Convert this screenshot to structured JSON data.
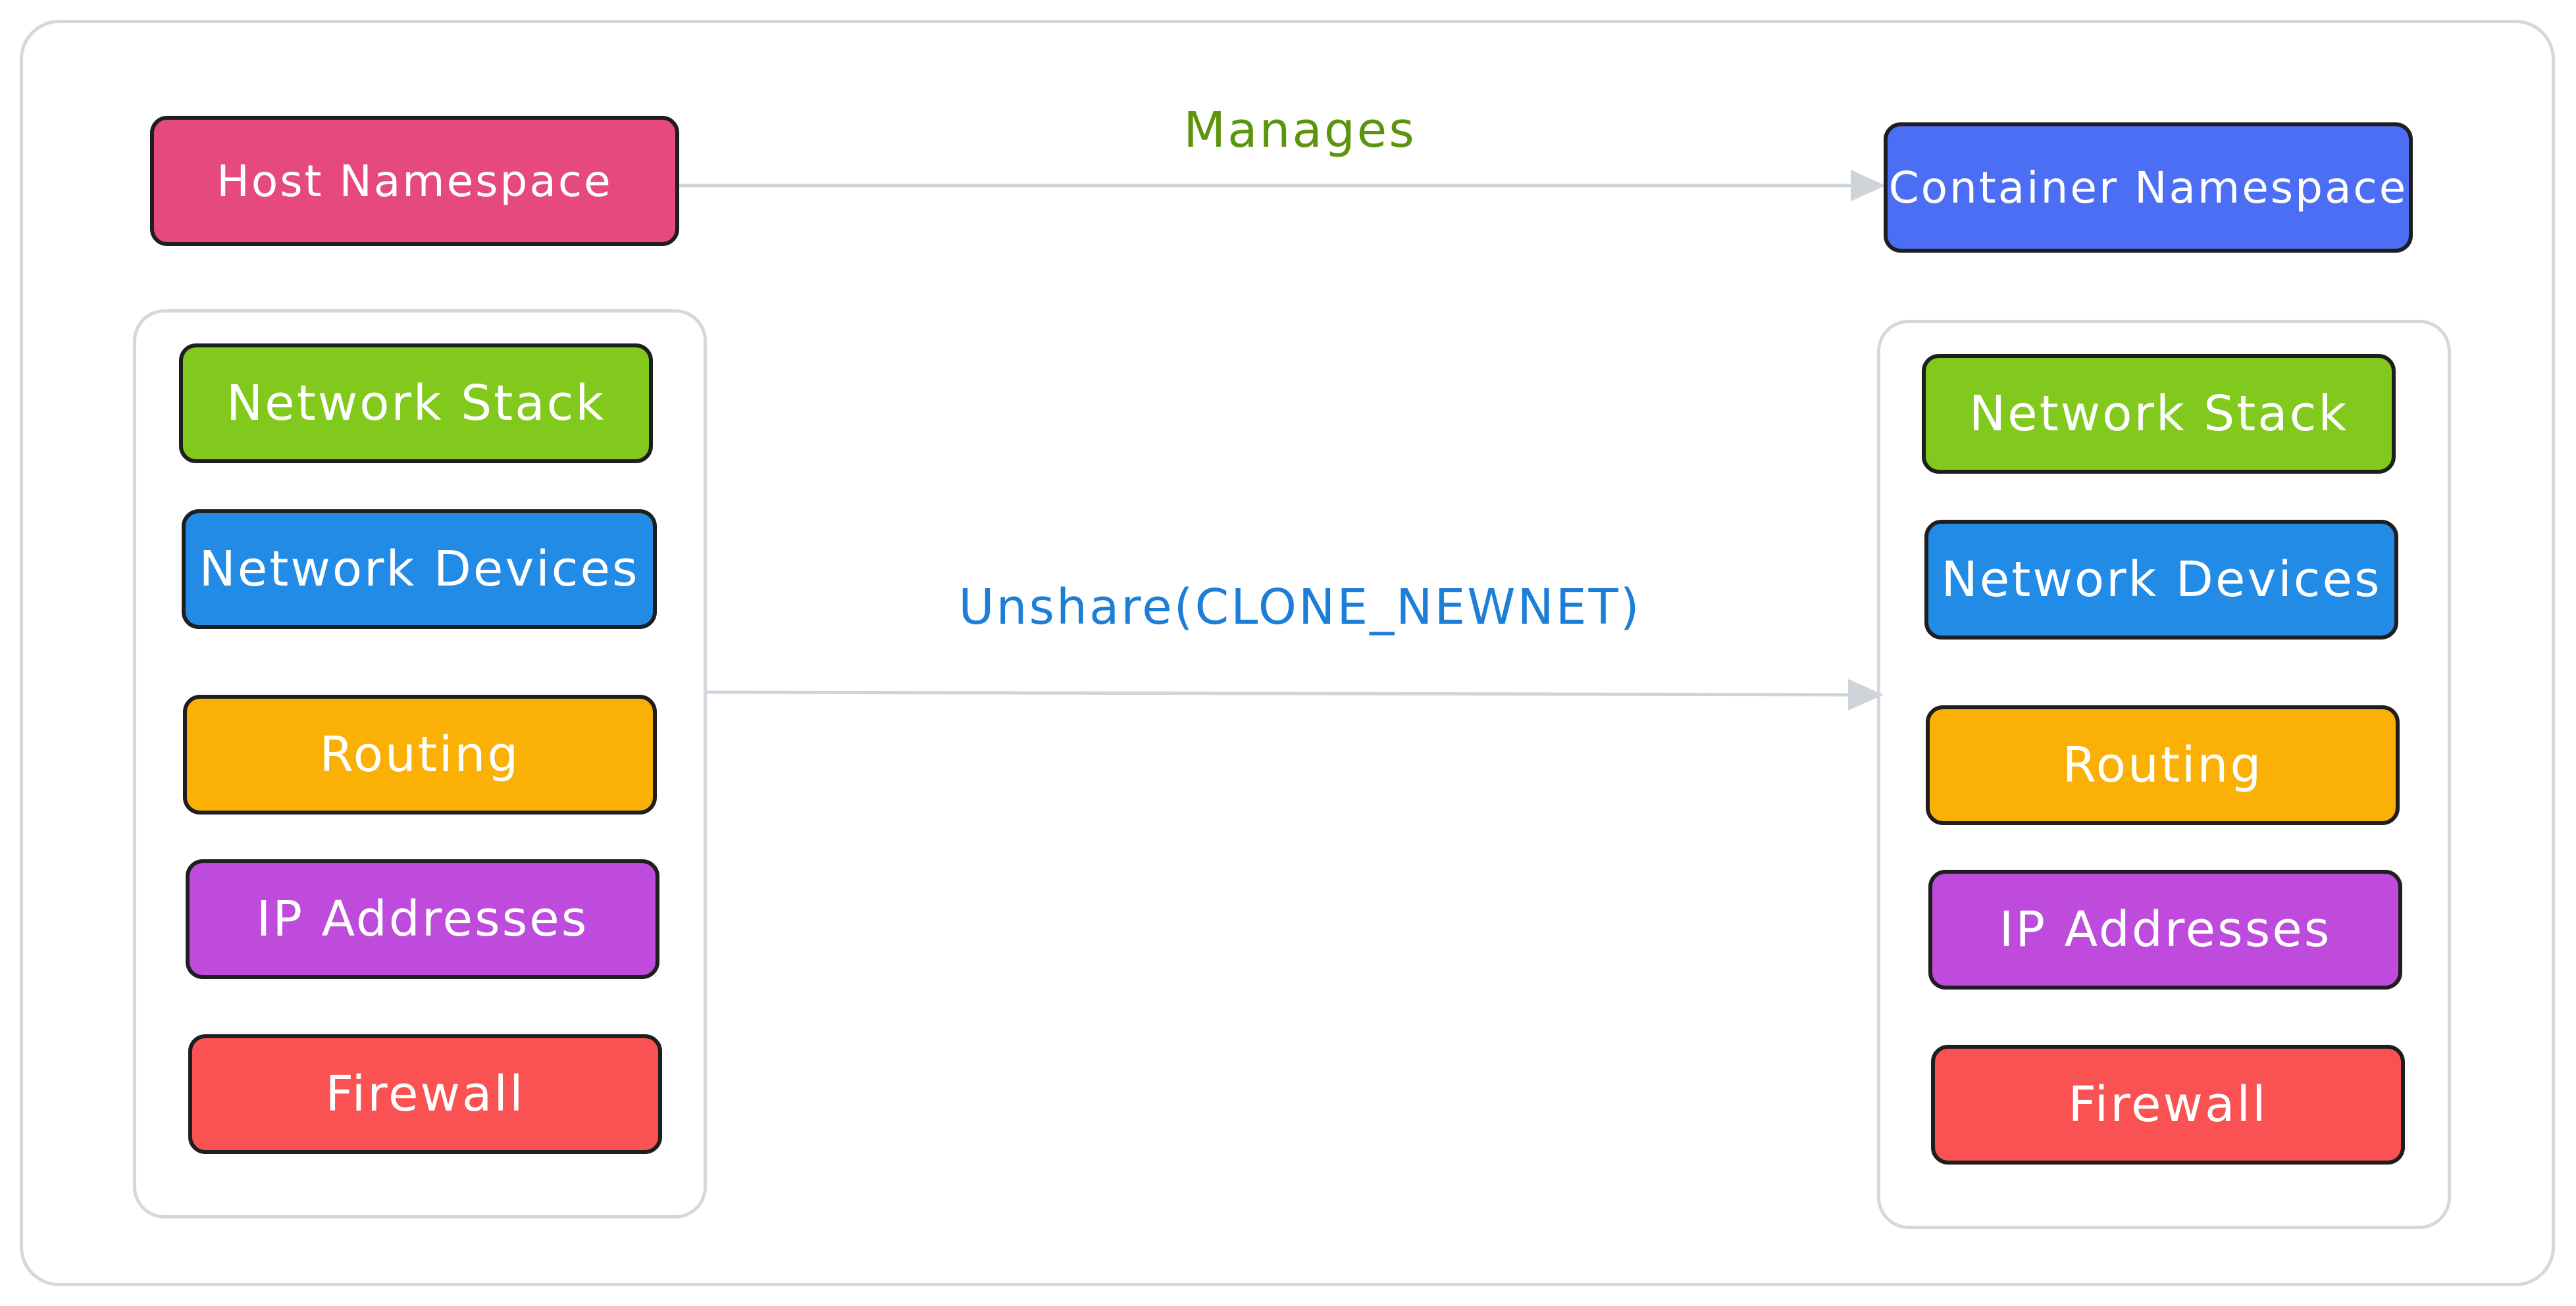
{
  "namespaces": {
    "host": {
      "label": "Host Namespace",
      "color": "#e64980"
    },
    "container": {
      "label": "Container Namespace",
      "color": "#4c6ef5"
    }
  },
  "edges": {
    "manages": {
      "label": "Manages",
      "color": "#5c940d"
    },
    "unshare": {
      "label": "Unshare(CLONE_NEWNET)",
      "color": "#1c7ed6"
    }
  },
  "host_components": [
    {
      "label": "Network Stack",
      "color": "#82c91e"
    },
    {
      "label": "Network Devices",
      "color": "#228be6"
    },
    {
      "label": "Routing",
      "color": "#fab005"
    },
    {
      "label": "IP Addresses",
      "color": "#be4bdb"
    },
    {
      "label": "Firewall",
      "color": "#fa5252"
    }
  ],
  "container_components": [
    {
      "label": "Network Stack",
      "color": "#82c91e"
    },
    {
      "label": "Network Devices",
      "color": "#228be6"
    },
    {
      "label": "Routing",
      "color": "#fab005"
    },
    {
      "label": "IP Addresses",
      "color": "#be4bdb"
    },
    {
      "label": "Firewall",
      "color": "#fa5252"
    }
  ],
  "colors": {
    "edge_line": "#ced4da",
    "frame": "#d4d8de",
    "node_border": "#1e1e1e"
  }
}
